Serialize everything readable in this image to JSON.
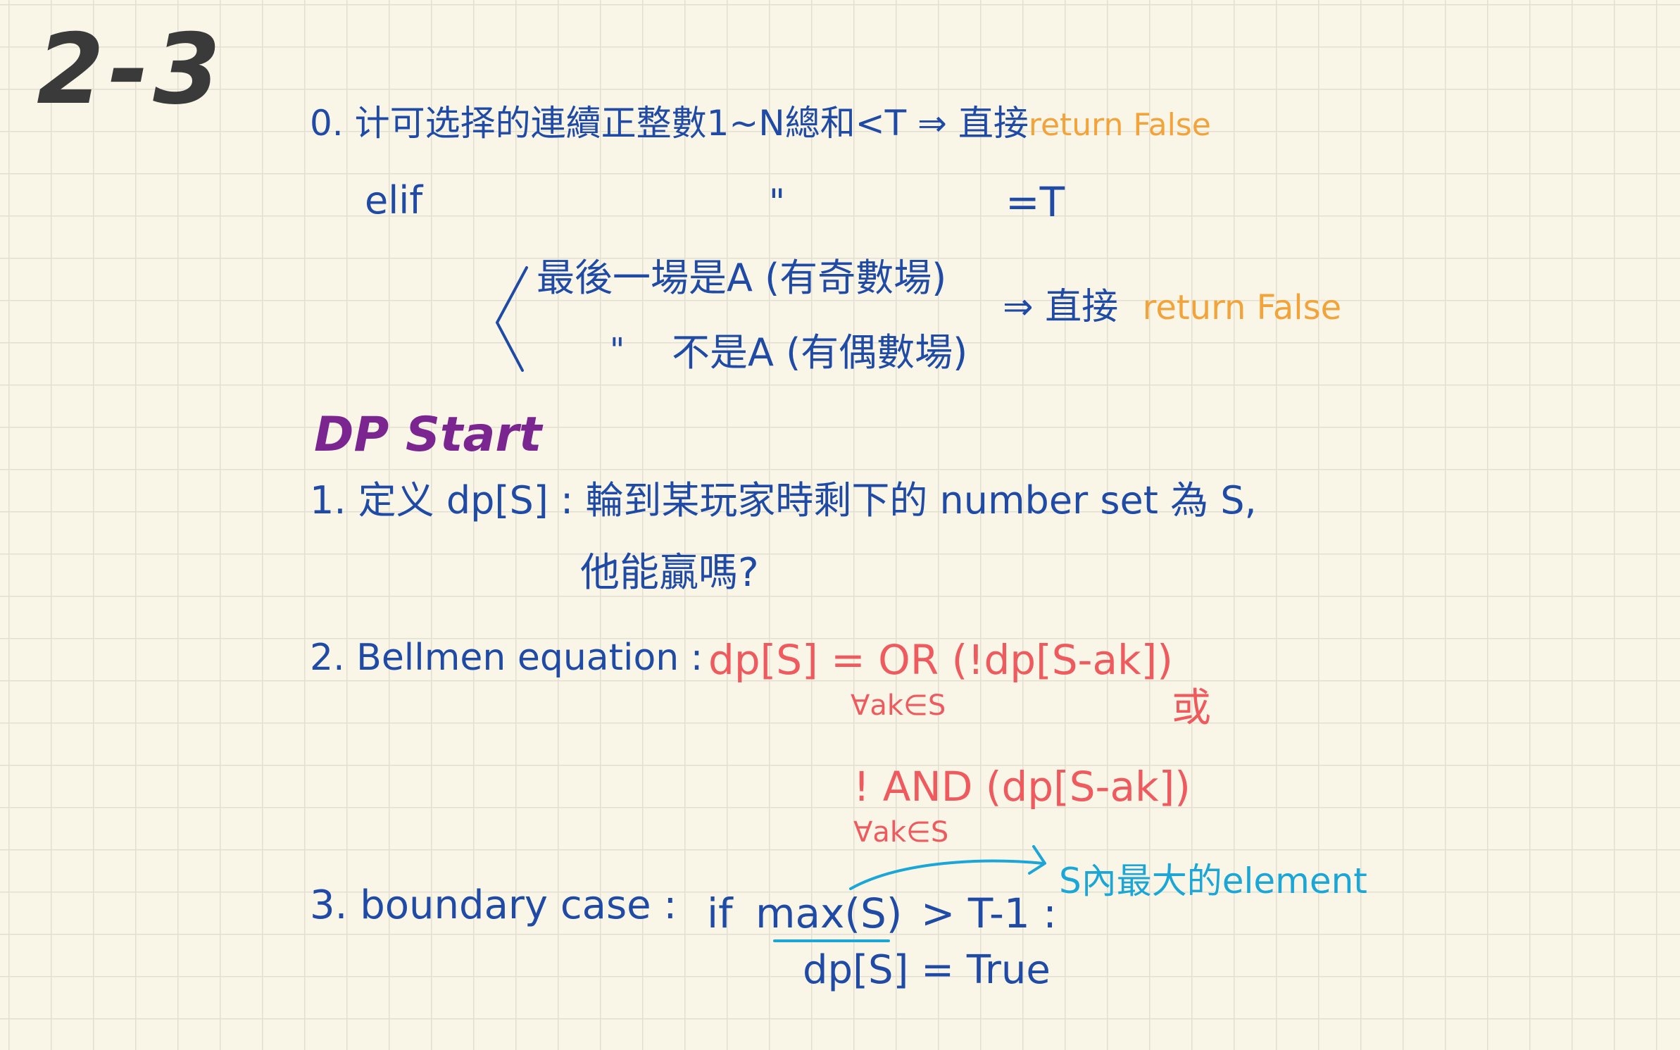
{
  "heading": "2-3",
  "step0": {
    "line1_prefix": "0. 计可选择的連續正整數1~N總和<T ⇒ 直接",
    "line1_result": "return False",
    "line2_elif": "elif",
    "line2_ditto": "\"",
    "line2_eq": "=T",
    "case1": "最後一場是A (有奇數場)",
    "case2_ditto": "\"",
    "case2": "不是A (有偶數場)",
    "case_arrow": "⇒ 直接",
    "case_result": "return False"
  },
  "dp_title": "DP Start",
  "step1": {
    "line1": "1. 定义 dp[S] : 輪到某玩家時剩下的 number set 為 S,",
    "line2": "他能贏嗎?"
  },
  "step2": {
    "label": "2. Bellmen equation :",
    "eq1": "dp[S] = OR (!dp[S-ak])",
    "eq1_sub": "∀ak∈S",
    "or_word": "或",
    "eq2": "! AND (dp[S-ak])",
    "eq2_sub": "∀ak∈S"
  },
  "step3": {
    "label": "3. boundary case :",
    "cond_if": "if",
    "cond_max": "max(S)",
    "cond_rest": "> T-1 :",
    "result": "dp[S] = True",
    "note": "S內最大的element"
  }
}
